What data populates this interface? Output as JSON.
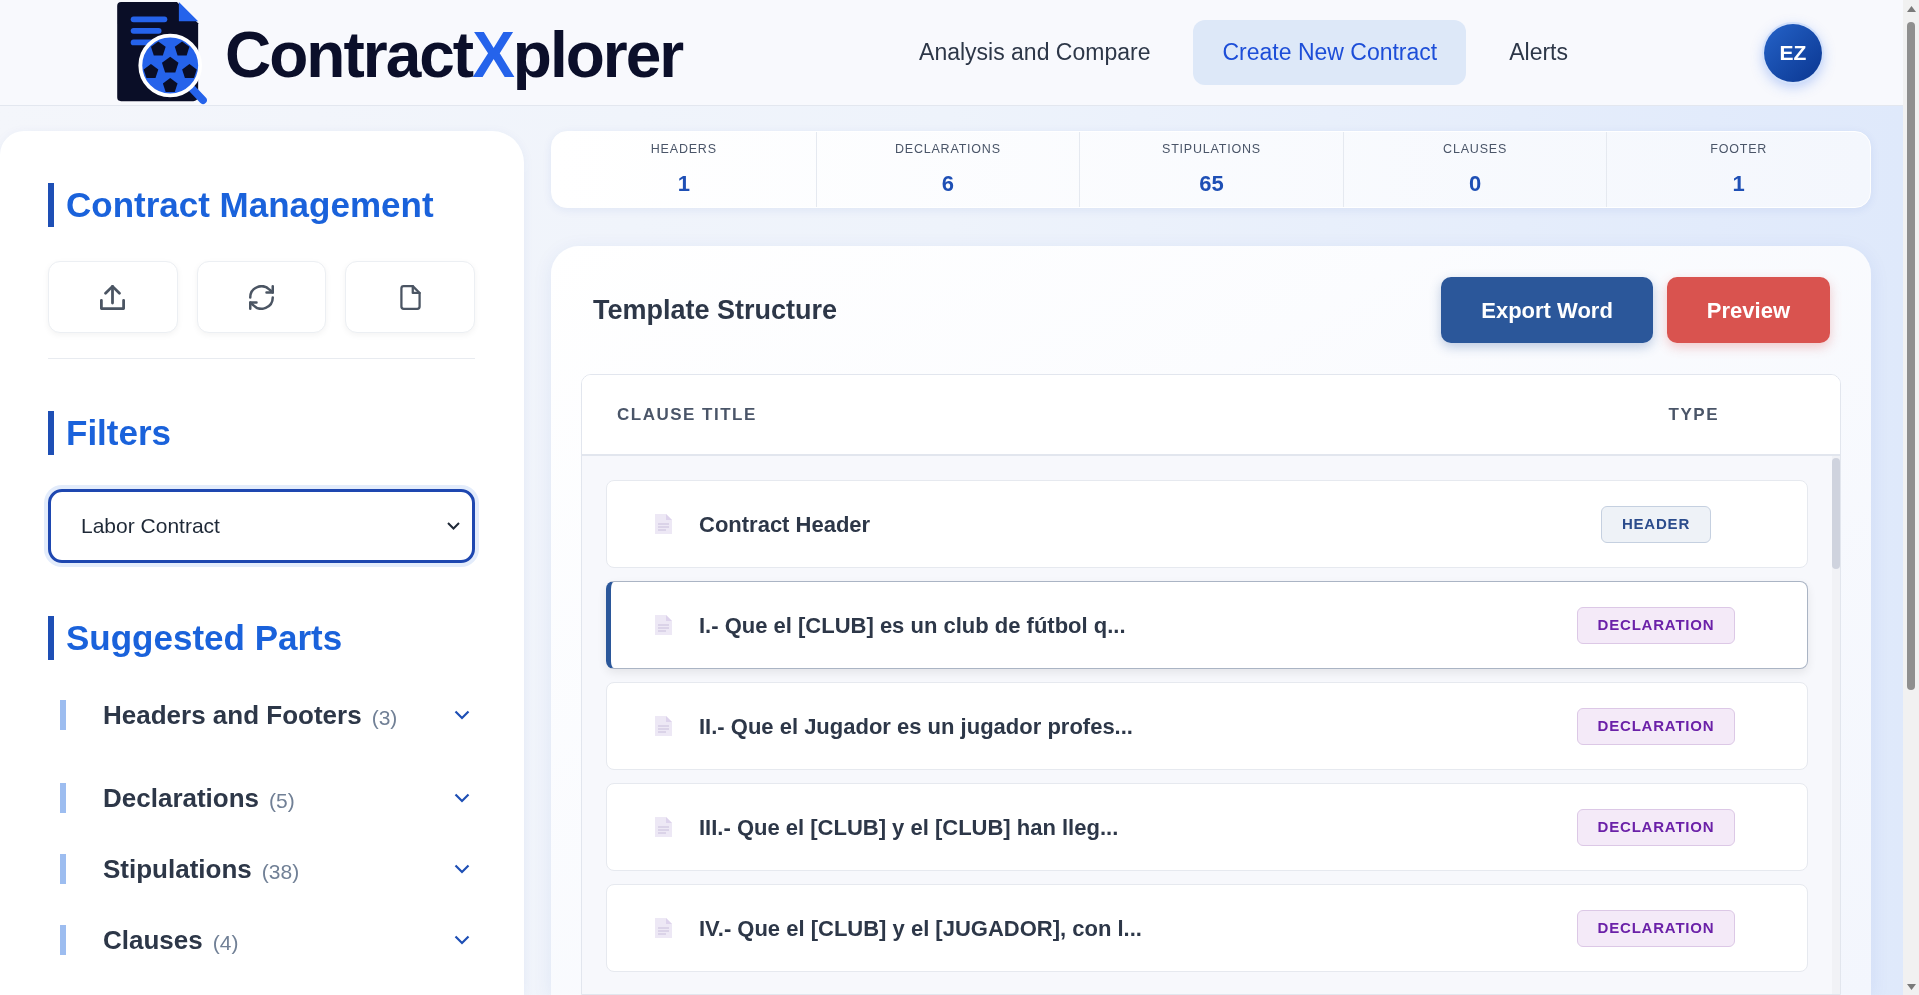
{
  "header": {
    "logo": {
      "text_start": "Contract",
      "text_highlight": "X",
      "text_end": "plorer"
    },
    "nav": [
      {
        "label": "Analysis and Compare",
        "selected": false
      },
      {
        "label": "Create New Contract",
        "selected": true
      },
      {
        "label": "Alerts",
        "selected": false
      }
    ],
    "avatar": {
      "initials": "EZ"
    }
  },
  "sidebar": {
    "management": {
      "title": "Contract Management"
    },
    "filters": {
      "title": "Filters",
      "select": {
        "value": "Labor Contract"
      }
    },
    "suggested_parts": {
      "title": "Suggested Parts",
      "items": [
        {
          "label": "Headers and Footers",
          "count": "(3)",
          "expanded": false
        },
        {
          "label": "Declarations",
          "count": "(5)",
          "expanded": false
        },
        {
          "label": "Stipulations",
          "count": "(38)",
          "expanded": false
        },
        {
          "label": "Clauses",
          "count": "(4)",
          "expanded": false
        }
      ]
    }
  },
  "stats": [
    {
      "label": "HEADERS",
      "value": "1"
    },
    {
      "label": "DECLARATIONS",
      "value": "6"
    },
    {
      "label": "STIPULATIONS",
      "value": "65"
    },
    {
      "label": "CLAUSES",
      "value": "0"
    },
    {
      "label": "FOOTER",
      "value": "1"
    }
  ],
  "template": {
    "title": "Template Structure",
    "buttons": [
      {
        "label": "Export Word",
        "kind": "primary"
      },
      {
        "label": "Preview",
        "kind": "danger"
      }
    ],
    "table": {
      "columns": [
        "CLAUSE TITLE",
        "TYPE"
      ],
      "rows": [
        {
          "title": "Contract Header",
          "type": "HEADER",
          "kind": "header",
          "selected": false
        },
        {
          "title": "I.- Que el [CLUB] es un club de fútbol q...",
          "type": "DECLARATION",
          "kind": "declaration",
          "selected": true
        },
        {
          "title": "II.- Que el Jugador es un jugador profes...",
          "type": "DECLARATION",
          "kind": "declaration",
          "selected": false
        },
        {
          "title": "III.- Que el [CLUB] y el [CLUB] han lleg...",
          "type": "DECLARATION",
          "kind": "declaration",
          "selected": false
        },
        {
          "title": "IV.- Que el [CLUB] y el [JUGADOR], con l...",
          "type": "DECLARATION",
          "kind": "declaration",
          "selected": false
        }
      ]
    }
  }
}
